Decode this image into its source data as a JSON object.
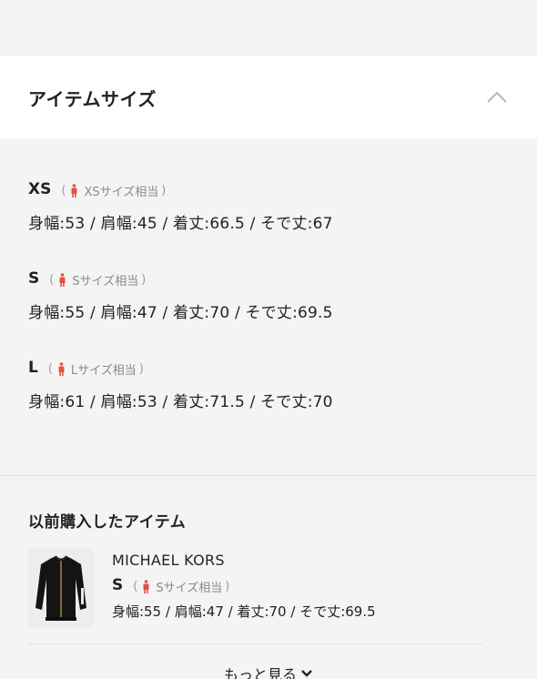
{
  "section": {
    "title": "アイテムサイズ",
    "toggle_icon": "chevron-up-icon"
  },
  "sizes": [
    {
      "name": "XS",
      "equiv": "XSサイズ相当",
      "measure": "身幅:53 / 肩幅:45 / 着丈:66.5 / そで丈:67"
    },
    {
      "name": "S",
      "equiv": "Sサイズ相当",
      "measure": "身幅:55 / 肩幅:47 / 着丈:70 / そで丈:69.5"
    },
    {
      "name": "L",
      "equiv": "Lサイズ相当",
      "measure": "身幅:61 / 肩幅:53 / 着丈:71.5 / そで丈:70"
    }
  ],
  "previous": {
    "title": "以前購入したアイテム",
    "items": [
      {
        "brand": "MICHAEL KORS",
        "size": "S",
        "equiv": "Sサイズ相当",
        "measure": "身幅:55 / 肩幅:47 / 着丈:70 / そで丈:69.5"
      }
    ],
    "more_label": "もっと見る"
  },
  "colors": {
    "background": "#f4f4f4",
    "header_bg": "#ffffff",
    "person_icon": "#e0533f",
    "muted_text": "#8a8a8a"
  }
}
